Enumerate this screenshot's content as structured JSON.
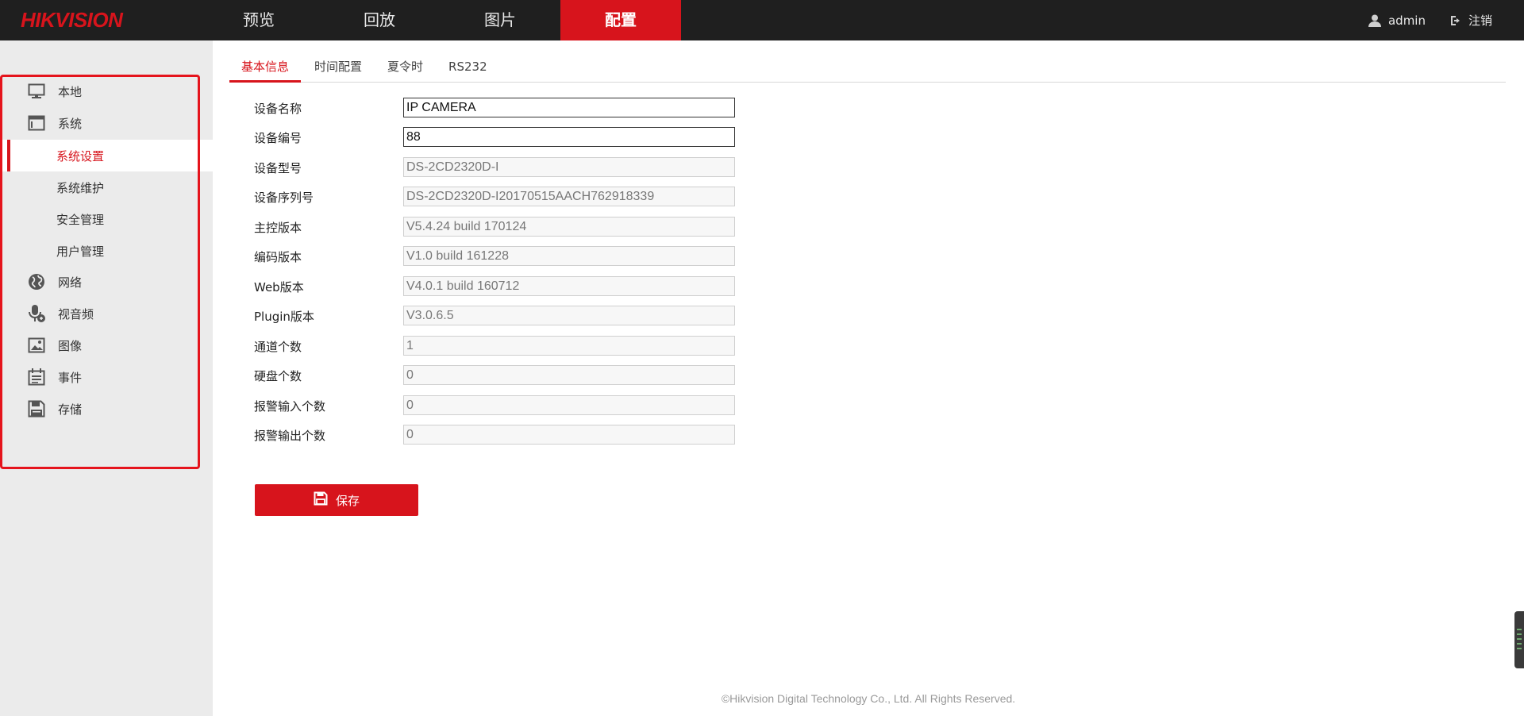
{
  "brand": {
    "logo_text": "HIKVISION",
    "accent": "#d7141c"
  },
  "nav": {
    "items": [
      {
        "label": "预览"
      },
      {
        "label": "回放"
      },
      {
        "label": "图片"
      },
      {
        "label": "配置"
      }
    ],
    "active_index": 3
  },
  "user": {
    "name": "admin",
    "logout_label": "注销"
  },
  "sidebar": {
    "items": [
      {
        "label": "本地",
        "icon": "monitor-icon"
      },
      {
        "label": "系统",
        "icon": "window-icon"
      },
      {
        "label": "系统设置",
        "sub": true,
        "active": true
      },
      {
        "label": "系统维护",
        "sub": true
      },
      {
        "label": "安全管理",
        "sub": true
      },
      {
        "label": "用户管理",
        "sub": true
      },
      {
        "label": "网络",
        "icon": "globe-icon"
      },
      {
        "label": "视音频",
        "icon": "microphone-icon"
      },
      {
        "label": "图像",
        "icon": "image-icon"
      },
      {
        "label": "事件",
        "icon": "calendar-icon"
      },
      {
        "label": "存储",
        "icon": "floppy-icon"
      }
    ]
  },
  "tabs": {
    "items": [
      {
        "label": "基本信息"
      },
      {
        "label": "时间配置"
      },
      {
        "label": "夏令时"
      },
      {
        "label": "RS232"
      }
    ],
    "active_index": 0
  },
  "form": {
    "fields": [
      {
        "label": "设备名称",
        "value": "IP CAMERA",
        "editable": true
      },
      {
        "label": "设备编号",
        "value": "88",
        "editable": true
      },
      {
        "label": "设备型号",
        "value": "DS-2CD2320D-I",
        "editable": false
      },
      {
        "label": "设备序列号",
        "value": "DS-2CD2320D-I20170515AACH762918339",
        "editable": false
      },
      {
        "label": "主控版本",
        "value": "V5.4.24 build 170124",
        "editable": false
      },
      {
        "label": "编码版本",
        "value": "V1.0 build 161228",
        "editable": false
      },
      {
        "label": "Web版本",
        "value": "V4.0.1 build 160712",
        "editable": false
      },
      {
        "label": "Plugin版本",
        "value": "V3.0.6.5",
        "editable": false
      },
      {
        "label": "通道个数",
        "value": "1",
        "editable": false
      },
      {
        "label": "硬盘个数",
        "value": "0",
        "editable": false
      },
      {
        "label": "报警输入个数",
        "value": "0",
        "editable": false
      },
      {
        "label": "报警输出个数",
        "value": "0",
        "editable": false
      }
    ],
    "save_label": "保存"
  },
  "footer": {
    "copyright": "©Hikvision Digital Technology Co., Ltd. All Rights Reserved."
  }
}
